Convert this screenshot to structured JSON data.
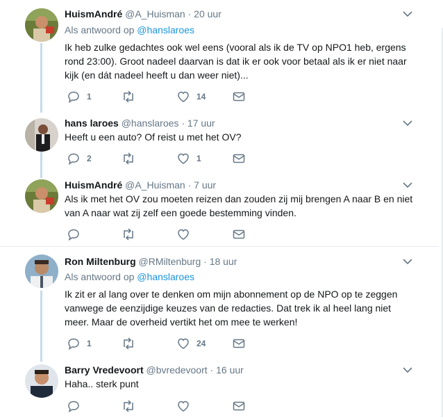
{
  "tweets": [
    {
      "name": "HuismAndré",
      "handle": "@A_Huisman",
      "time": "20 uur",
      "reply_prefix": "Als antwoord op",
      "reply_handle": "@hanslaroes",
      "lines": [
        "Ik heb zulke gedachtes ook wel eens (vooral als ik de TV op NPO1 heb, ergens",
        "rond 23:00). Groot nadeel daarvan is dat ik er ook voor betaal als ik er niet naar",
        "kijk (en dát nadeel heeft u dan weer niet)..."
      ],
      "replies": "1",
      "retweets": "",
      "likes": "14"
    },
    {
      "name": "hans laroes",
      "handle": "@hanslaroes",
      "time": "17 uur",
      "lines": [
        "Heeft u een auto? Of reist u met het OV?"
      ],
      "replies": "2",
      "retweets": "",
      "likes": "1"
    },
    {
      "name": "HuismAndré",
      "handle": "@A_Huisman",
      "time": "7 uur",
      "lines": [
        "Als ik met het OV zou moeten reizen dan zouden zij mij brengen A naar B en niet",
        "van A naar wat zij zelf een goede bestemming vinden."
      ],
      "replies": "",
      "retweets": "",
      "likes": ""
    },
    {
      "name": "Ron Miltenburg",
      "handle": "@RMiltenburg",
      "time": "18 uur",
      "reply_prefix": "Als antwoord op",
      "reply_handle": "@hanslaroes",
      "lines": [
        "Ik zit er al lang over te denken om mijn abonnement op de NPO op te zeggen",
        "vanwege de eenzijdige keuzes van de redacties. Dat trek ik al heel lang niet",
        "meer. Maar de overheid vertikt het om mee te werken!"
      ],
      "replies": "1",
      "retweets": "",
      "likes": "24"
    },
    {
      "name": "Barry Vredevoort",
      "handle": "@bvredevoort",
      "time": "16 uur",
      "lines": [
        "Haha.. sterk punt"
      ],
      "replies": "",
      "retweets": "",
      "likes": ""
    }
  ],
  "colors": {
    "text": "#14171a",
    "meta": "#657786",
    "link": "#1b95e0",
    "thread_line": "#c4dceb",
    "divider": "#e6ecf0"
  },
  "icons": [
    "reply-icon",
    "retweet-icon",
    "like-icon",
    "dm-icon",
    "chevron-down-icon"
  ]
}
